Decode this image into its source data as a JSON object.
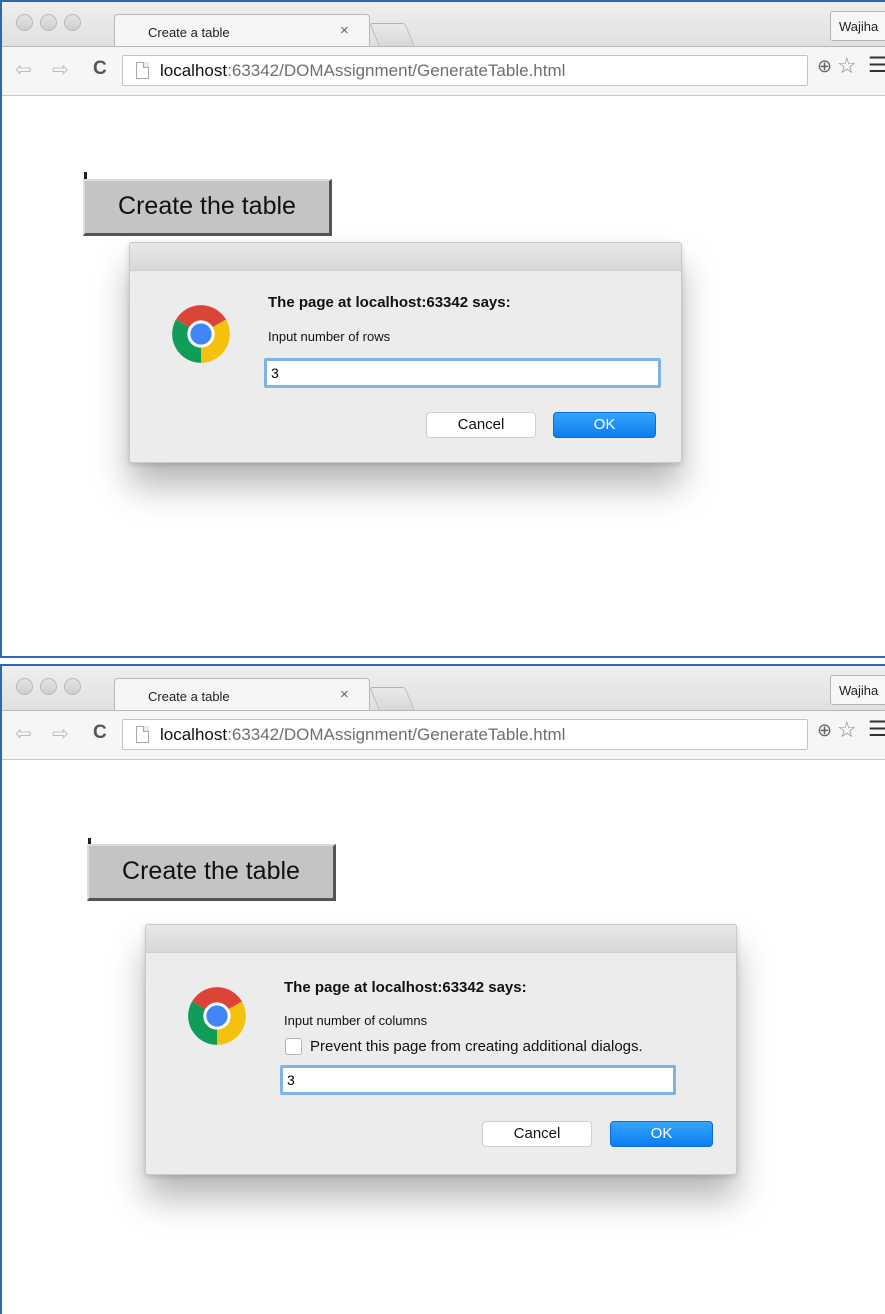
{
  "screens": [
    {
      "tab": {
        "title": "Create a table",
        "close": "×"
      },
      "profile": "Wajiha",
      "address": {
        "host": "localhost",
        "rest": ":63342/DOMAssignment/GenerateTable.html"
      },
      "page": {
        "button_label": "Create the table"
      },
      "dialog": {
        "heading": "The page at localhost:63342 says:",
        "message": "Input number of rows",
        "input_value": "3",
        "cancel_label": "Cancel",
        "ok_label": "OK"
      }
    },
    {
      "tab": {
        "title": "Create a table",
        "close": "×"
      },
      "profile": "Wajiha",
      "address": {
        "host": "localhost",
        "rest": ":63342/DOMAssignment/GenerateTable.html"
      },
      "page": {
        "button_label": "Create the table"
      },
      "dialog": {
        "heading": "The page at localhost:63342 says:",
        "message": "Input number of columns",
        "checkbox_label": "Prevent this page from creating additional dialogs.",
        "checkbox_checked": false,
        "input_value": "3",
        "cancel_label": "Cancel",
        "ok_label": "OK"
      }
    }
  ],
  "icons": {
    "back": "back-arrow-icon",
    "forward": "forward-arrow-icon",
    "reload": "reload-icon",
    "page": "page-icon",
    "zoom": "zoom-icon",
    "star": "bookmark-star-icon",
    "menu": "hamburger-menu-icon",
    "logo": "chrome-logo-icon"
  },
  "colors": {
    "ok_button": "#0c7cf2",
    "input_focus": "#7fb3e6",
    "frame_border": "#2f67b6"
  }
}
